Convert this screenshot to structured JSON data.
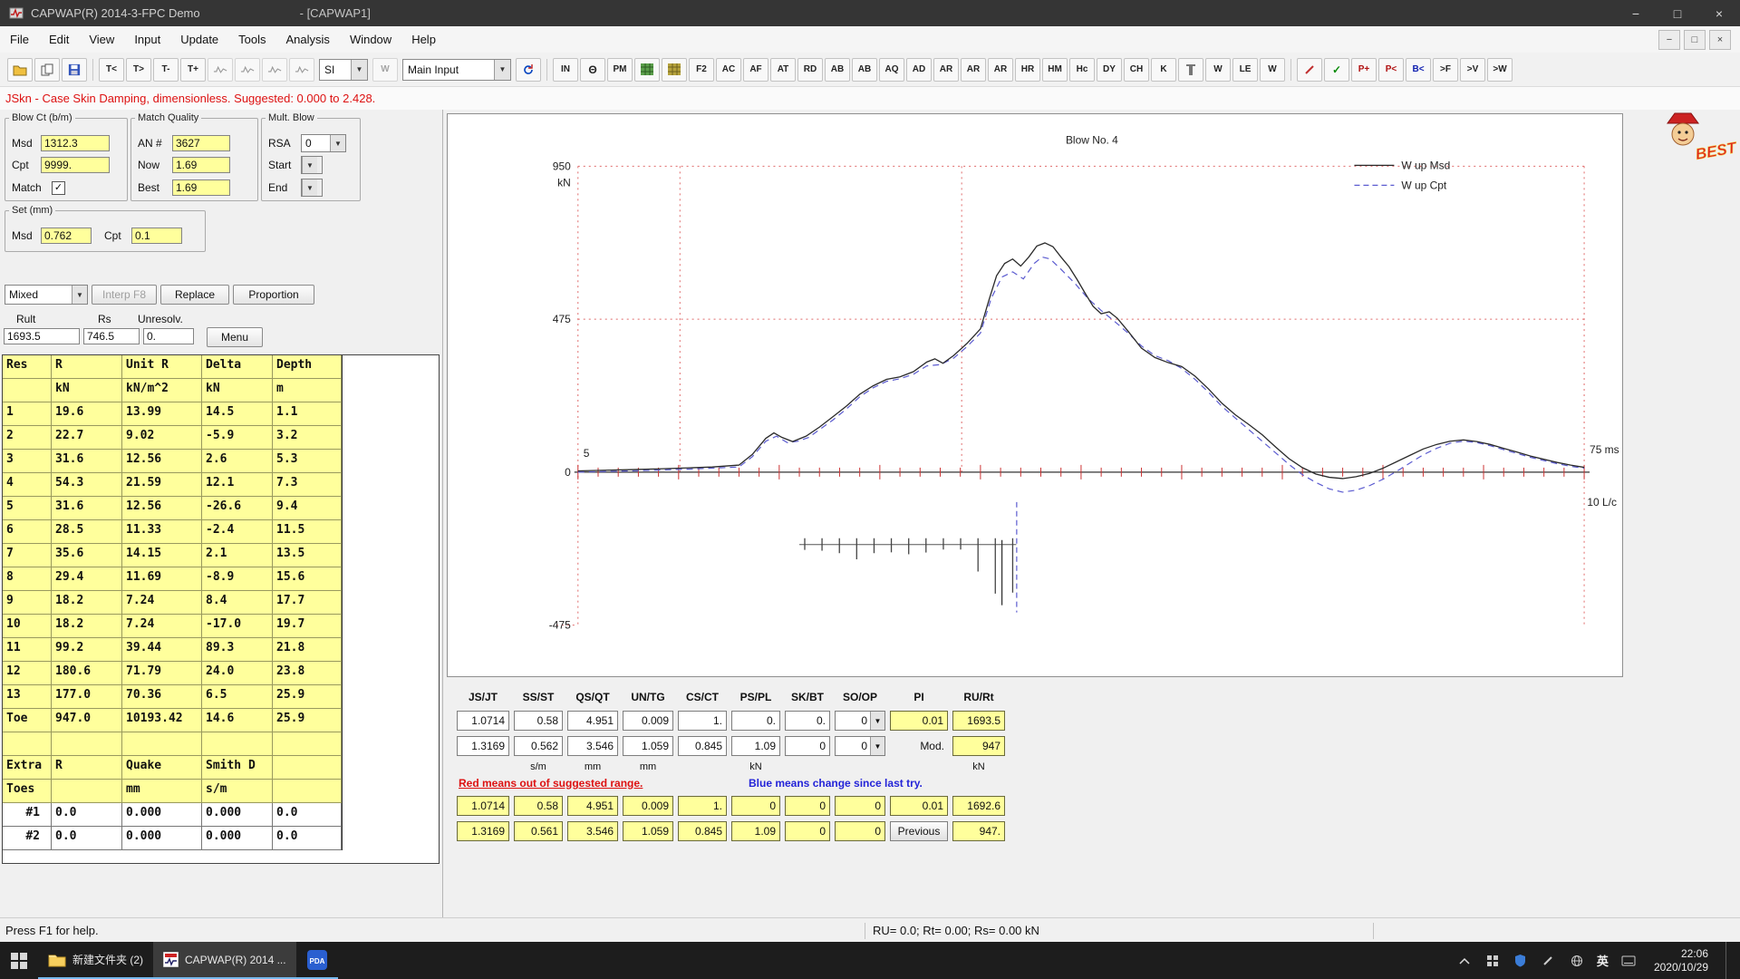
{
  "window": {
    "title": "CAPWAP(R) 2014-3-FPC Demo",
    "doc_title": "- [CAPWAP1]",
    "controls": {
      "minimize": "−",
      "maximize": "□",
      "close": "×"
    }
  },
  "menu": {
    "items": [
      "File",
      "Edit",
      "View",
      "Input",
      "Update",
      "Tools",
      "Analysis",
      "Window",
      "Help"
    ]
  },
  "toolbar": {
    "unit_combo": "SI",
    "view_combo": "Main Input",
    "buttons": [
      {
        "icon": "open",
        "n": "open-button"
      },
      {
        "icon": "pages",
        "n": "compare-button"
      },
      {
        "icon": "save",
        "n": "save-button"
      },
      {
        "sep": true
      },
      {
        "t": "T<"
      },
      {
        "t": "T>"
      },
      {
        "t": "T-"
      },
      {
        "t": "T+"
      },
      {
        "icon": "wave",
        "d": true,
        "n": "wave-1-button"
      },
      {
        "icon": "wave",
        "d": true,
        "n": "wave-2-button"
      },
      {
        "icon": "wave",
        "d": true,
        "n": "wave-3-button"
      },
      {
        "icon": "wave",
        "d": true,
        "n": "wave-4-button"
      },
      {
        "combo": "unit",
        "n": "unit-system-select"
      },
      {
        "t": "W",
        "d": true
      },
      {
        "combo": "view",
        "n": "view-select"
      },
      {
        "icon": "refresh",
        "n": "refresh-button"
      },
      {
        "sep": true
      },
      {
        "t": "IN"
      },
      {
        "icon": "theta",
        "n": "theta-button"
      },
      {
        "t": "PM"
      },
      {
        "icon": "gridg",
        "n": "grid-green-button"
      },
      {
        "icon": "grido",
        "n": "grid-olive-button"
      },
      {
        "t": "F2"
      },
      {
        "t": "AC"
      },
      {
        "t": "AF"
      },
      {
        "t": "AT"
      },
      {
        "t": "RD"
      },
      {
        "t": "AB"
      },
      {
        "t": "AB"
      },
      {
        "t": "AQ"
      },
      {
        "t": "AD"
      },
      {
        "t": "AR"
      },
      {
        "t": "AR"
      },
      {
        "t": "AR"
      },
      {
        "t": "HR"
      },
      {
        "t": "HM"
      },
      {
        "t": "Hc"
      },
      {
        "t": "DY"
      },
      {
        "t": "CH"
      },
      {
        "t": "K"
      },
      {
        "icon": "pile",
        "n": "pile-button"
      },
      {
        "t": "W"
      },
      {
        "t": "LE"
      },
      {
        "t": "W"
      },
      {
        "sep": true
      },
      {
        "icon": "pen",
        "n": "pen-button"
      },
      {
        "icon": "check",
        "n": "check-button"
      },
      {
        "t": "P+",
        "c": "#b01010"
      },
      {
        "t": "P<",
        "c": "#b01010"
      },
      {
        "t": "B<",
        "c": "#1020b0"
      },
      {
        "t": ">F"
      },
      {
        "t": ">V"
      },
      {
        "t": ">W"
      }
    ]
  },
  "warning": {
    "text": "JSkn - Case Skin Damping, dimensionless. Suggested: 0.000 to 2.428."
  },
  "left_panel": {
    "blow_ct": {
      "title": "Blow Ct (b/m)",
      "msd_label": "Msd",
      "msd": "1312.3",
      "cpt_label": "Cpt",
      "cpt": "9999.",
      "match_label": "Match",
      "match_checked": "✓"
    },
    "match_quality": {
      "title": "Match Quality",
      "an_label": "AN #",
      "an": "3627",
      "now_label": "Now",
      "now": "1.69",
      "best_label": "Best",
      "best": "1.69"
    },
    "mult_blow": {
      "title": "Mult. Blow",
      "rsa_label": "RSA",
      "rsa": "0",
      "start_label": "Start",
      "end_label": "End"
    },
    "set_mm": {
      "title": "Set (mm)",
      "msd_label": "Msd",
      "msd": "0.762",
      "cpt_label": "Cpt",
      "cpt": "0.1"
    },
    "dist_controls": {
      "combo": "Mixed",
      "buttons": [
        "Interp F8",
        "Replace",
        "Proportion"
      ]
    },
    "totals": {
      "labels": [
        "Rult",
        "Rs",
        "Unresolv."
      ],
      "values": [
        "1693.5",
        "746.5",
        "0."
      ],
      "menu_label": "Menu"
    },
    "res_table": {
      "headers": [
        "Res",
        "R",
        "Unit R",
        "Delta",
        "Depth"
      ],
      "units": [
        "",
        "kN",
        "kN/m^2",
        "kN",
        "m"
      ],
      "rows": [
        [
          "1",
          "19.6",
          "13.99",
          "14.5",
          "1.1"
        ],
        [
          "2",
          "22.7",
          "9.02",
          "-5.9",
          "3.2"
        ],
        [
          "3",
          "31.6",
          "12.56",
          "2.6",
          "5.3"
        ],
        [
          "4",
          "54.3",
          "21.59",
          "12.1",
          "7.3"
        ],
        [
          "5",
          "31.6",
          "12.56",
          "-26.6",
          "9.4"
        ],
        [
          "6",
          "28.5",
          "11.33",
          "-2.4",
          "11.5"
        ],
        [
          "7",
          "35.6",
          "14.15",
          "2.1",
          "13.5"
        ],
        [
          "8",
          "29.4",
          "11.69",
          "-8.9",
          "15.6"
        ],
        [
          "9",
          "18.2",
          "7.24",
          "8.4",
          "17.7"
        ],
        [
          "10",
          "18.2",
          "7.24",
          "-17.0",
          "19.7"
        ],
        [
          "11",
          "99.2",
          "39.44",
          "89.3",
          "21.8"
        ],
        [
          "12",
          "180.6",
          "71.79",
          "24.0",
          "23.8"
        ],
        [
          "13",
          "177.0",
          "70.36",
          "6.5",
          "25.9"
        ],
        [
          "Toe",
          "947.0",
          "10193.42",
          "14.6",
          "25.9"
        ]
      ],
      "extra_headers": [
        "Extra",
        "R",
        "Quake",
        "Smith D",
        ""
      ],
      "extra_units": [
        "Toes",
        "",
        "mm",
        "s/m",
        ""
      ],
      "extra_rows": [
        [
          "#1",
          "0.0",
          "0.000",
          "0.000",
          "0.0"
        ],
        [
          "#2",
          "0.0",
          "0.000",
          "0.000",
          "0.0"
        ]
      ]
    }
  },
  "chart_data": {
    "type": "line",
    "title": "Blow No. 4",
    "y_unit": "kN",
    "y_ticks": [
      950,
      475,
      0,
      -475
    ],
    "ylim": [
      -475,
      950
    ],
    "xlim_ms": [
      0,
      75
    ],
    "x_max_label": "75 ms",
    "x_secondary_label": "10 L/c",
    "scale_marker": "5",
    "grid": "dotted-red",
    "legend_position": "top-right",
    "series": [
      {
        "name": "W up Msd",
        "style": "solid",
        "color": "#2a2a2a",
        "points": [
          [
            0,
            4
          ],
          [
            2,
            6
          ],
          [
            4,
            8
          ],
          [
            6,
            10
          ],
          [
            8,
            13
          ],
          [
            10,
            16
          ],
          [
            12,
            22
          ],
          [
            13,
            55
          ],
          [
            14,
            105
          ],
          [
            14.6,
            122
          ],
          [
            15.2,
            108
          ],
          [
            16,
            95
          ],
          [
            17,
            112
          ],
          [
            18,
            140
          ],
          [
            19,
            172
          ],
          [
            20,
            205
          ],
          [
            21,
            242
          ],
          [
            22,
            268
          ],
          [
            23,
            288
          ],
          [
            24,
            296
          ],
          [
            25,
            312
          ],
          [
            26,
            342
          ],
          [
            26.6,
            352
          ],
          [
            27.2,
            338
          ],
          [
            28,
            362
          ],
          [
            29,
            400
          ],
          [
            30,
            445
          ],
          [
            30.6,
            530
          ],
          [
            31.2,
            610
          ],
          [
            31.8,
            648
          ],
          [
            32.4,
            662
          ],
          [
            33,
            640
          ],
          [
            33.6,
            668
          ],
          [
            34.2,
            702
          ],
          [
            34.8,
            712
          ],
          [
            35.4,
            700
          ],
          [
            36,
            668
          ],
          [
            36.6,
            638
          ],
          [
            37.2,
            598
          ],
          [
            37.8,
            556
          ],
          [
            38.4,
            515
          ],
          [
            39,
            492
          ],
          [
            39.6,
            498
          ],
          [
            40.2,
            478
          ],
          [
            41,
            438
          ],
          [
            42,
            385
          ],
          [
            43,
            356
          ],
          [
            44,
            340
          ],
          [
            45,
            328
          ],
          [
            46,
            298
          ],
          [
            47,
            258
          ],
          [
            48,
            214
          ],
          [
            49,
            178
          ],
          [
            50,
            148
          ],
          [
            51,
            116
          ],
          [
            52,
            78
          ],
          [
            53,
            42
          ],
          [
            54,
            14
          ],
          [
            55,
            -6
          ],
          [
            56,
            -16
          ],
          [
            57,
            -20
          ],
          [
            58,
            -14
          ],
          [
            59,
            -4
          ],
          [
            60,
            12
          ],
          [
            61,
            32
          ],
          [
            62,
            52
          ],
          [
            63,
            72
          ],
          [
            64,
            86
          ],
          [
            65,
            96
          ],
          [
            66,
            100
          ],
          [
            67,
            95
          ],
          [
            68,
            86
          ],
          [
            69,
            74
          ],
          [
            70,
            62
          ],
          [
            71,
            50
          ],
          [
            72,
            40
          ],
          [
            73,
            30
          ],
          [
            74,
            22
          ],
          [
            75,
            15
          ]
        ]
      },
      {
        "name": "W up Cpt",
        "style": "dashed",
        "color": "#5b5bd0",
        "points": [
          [
            0,
            0
          ],
          [
            4,
            4
          ],
          [
            8,
            9
          ],
          [
            12,
            16
          ],
          [
            13,
            48
          ],
          [
            14,
            96
          ],
          [
            14.8,
            112
          ],
          [
            15.6,
            92
          ],
          [
            16.4,
            96
          ],
          [
            17.2,
            108
          ],
          [
            18,
            132
          ],
          [
            19,
            162
          ],
          [
            20,
            196
          ],
          [
            21,
            234
          ],
          [
            22,
            262
          ],
          [
            23,
            282
          ],
          [
            24,
            290
          ],
          [
            25,
            304
          ],
          [
            26,
            330
          ],
          [
            27,
            334
          ],
          [
            28,
            354
          ],
          [
            29,
            390
          ],
          [
            30,
            432
          ],
          [
            30.8,
            540
          ],
          [
            31.6,
            606
          ],
          [
            32.4,
            622
          ],
          [
            33.2,
            600
          ],
          [
            34,
            648
          ],
          [
            34.6,
            668
          ],
          [
            35.2,
            662
          ],
          [
            36,
            630
          ],
          [
            37,
            588
          ],
          [
            38,
            540
          ],
          [
            39,
            502
          ],
          [
            40,
            468
          ],
          [
            41,
            432
          ],
          [
            42,
            392
          ],
          [
            43,
            362
          ],
          [
            44,
            346
          ],
          [
            45,
            322
          ],
          [
            46,
            288
          ],
          [
            47,
            248
          ],
          [
            48,
            204
          ],
          [
            49,
            168
          ],
          [
            50,
            132
          ],
          [
            51,
            96
          ],
          [
            52,
            60
          ],
          [
            53,
            24
          ],
          [
            54,
            -8
          ],
          [
            55,
            -32
          ],
          [
            56,
            -52
          ],
          [
            57,
            -62
          ],
          [
            58,
            -56
          ],
          [
            59,
            -42
          ],
          [
            60,
            -22
          ],
          [
            61,
            2
          ],
          [
            62,
            28
          ],
          [
            63,
            54
          ],
          [
            64,
            74
          ],
          [
            65,
            90
          ],
          [
            66,
            96
          ],
          [
            67,
            92
          ],
          [
            68,
            82
          ],
          [
            69,
            70
          ],
          [
            70,
            58
          ],
          [
            71,
            46
          ],
          [
            72,
            36
          ],
          [
            73,
            26
          ],
          [
            74,
            18
          ],
          [
            75,
            12
          ]
        ]
      }
    ],
    "resistance_bars": {
      "t_start": 16.9,
      "t_end": 32.4,
      "values": [
        19.6,
        22.7,
        31.6,
        54.3,
        31.6,
        28.5,
        35.6,
        29.4,
        18.2,
        18.2,
        99.2,
        180.6,
        177.0
      ],
      "toe_value": 947.0
    }
  },
  "param_table": {
    "headers": [
      "JS/JT",
      "SS/ST",
      "QS/QT",
      "UN/TG",
      "CS/CT",
      "PS/PL",
      "SK/BT",
      "SO/OP",
      "PI",
      "RU/Rt"
    ],
    "row1": [
      "1.0714",
      "0.58",
      "4.951",
      "0.009",
      "1.",
      "0.",
      "0.",
      "0",
      "0.01",
      "1693.5"
    ],
    "row2": [
      "1.3169",
      "0.562",
      "3.546",
      "1.059",
      "0.845",
      "1.09",
      "0",
      "0",
      "Mod.",
      "947"
    ],
    "units": [
      "",
      "s/m",
      "mm",
      "mm",
      "",
      "kN",
      "",
      "",
      "",
      "kN"
    ],
    "red_note": "Red means out of suggested range.",
    "blue_note": "Blue means change since last try.",
    "row3": [
      "1.0714",
      "0.58",
      "4.951",
      "0.009",
      "1.",
      "0",
      "0",
      "0",
      "0.01",
      "1692.6"
    ],
    "row4": [
      "1.3169",
      "0.561",
      "3.546",
      "1.059",
      "0.845",
      "1.09",
      "0",
      "0",
      "Previous",
      "947."
    ]
  },
  "status_bar": {
    "help": "Press F1 for help.",
    "values": "RU= 0.0; Rt= 0.00; Rs= 0.00 kN"
  },
  "taskbar": {
    "folder_label": "新建文件夹 (2)",
    "capwap_label": "CAPWAP(R) 2014 ...",
    "pda_label": "PDA",
    "ime": "英",
    "time": "22:06",
    "date": "2020/10/29"
  },
  "logo": {
    "text": "BEST!"
  }
}
